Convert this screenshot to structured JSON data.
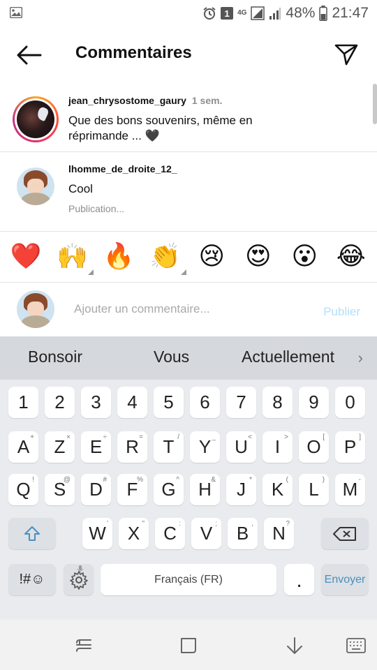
{
  "status_bar": {
    "image_icon": "image-icon",
    "alarm_icon": "alarm-icon",
    "sim_badge": "1",
    "network": "4G",
    "signal_icons": [
      "sim1-signal-icon",
      "sim2-signal-icon"
    ],
    "battery": "48%",
    "battery_icon": "battery-icon",
    "time": "21:47"
  },
  "header": {
    "title": "Commentaires",
    "back_icon": "back-arrow-icon",
    "share_icon": "paper-plane-icon"
  },
  "comments": [
    {
      "username": "jean_chrysostome_gaury",
      "time": "1 sem.",
      "text": "Que des bons souvenirs, même en réprimande ... 🖤",
      "has_story": true
    },
    {
      "username": "lhomme_de_droite_12_",
      "text": "Cool",
      "status": "Publication..."
    }
  ],
  "emoji_bar": [
    "❤️",
    "🙌",
    "🔥",
    "👏",
    "😢",
    "😍",
    "😮",
    "😂"
  ],
  "comment_input": {
    "placeholder": "Ajouter un commentaire...",
    "publish": "Publier"
  },
  "keyboard": {
    "suggestions": [
      "Bonsoir",
      "Vous",
      "Actuellement"
    ],
    "number_row": [
      "1",
      "2",
      "3",
      "4",
      "5",
      "6",
      "7",
      "8",
      "9",
      "0"
    ],
    "row1": [
      {
        "k": "A",
        "s": "+"
      },
      {
        "k": "Z",
        "s": "×"
      },
      {
        "k": "E",
        "s": "÷"
      },
      {
        "k": "R",
        "s": "="
      },
      {
        "k": "T",
        "s": "/"
      },
      {
        "k": "Y",
        "s": "_"
      },
      {
        "k": "U",
        "s": "<"
      },
      {
        "k": "I",
        "s": ">"
      },
      {
        "k": "O",
        "s": "["
      },
      {
        "k": "P",
        "s": "]"
      }
    ],
    "row2": [
      {
        "k": "Q",
        "s": "!"
      },
      {
        "k": "S",
        "s": "@"
      },
      {
        "k": "D",
        "s": "#"
      },
      {
        "k": "F",
        "s": "%"
      },
      {
        "k": "G",
        "s": "^"
      },
      {
        "k": "H",
        "s": "&"
      },
      {
        "k": "J",
        "s": "*"
      },
      {
        "k": "K",
        "s": "("
      },
      {
        "k": "L",
        "s": ")"
      },
      {
        "k": "M",
        "s": "-"
      }
    ],
    "row3": [
      {
        "k": "W",
        "s": "'"
      },
      {
        "k": "X",
        "s": "\""
      },
      {
        "k": "C",
        "s": ":"
      },
      {
        "k": "V",
        "s": ";"
      },
      {
        "k": "B",
        "s": ","
      },
      {
        "k": "N",
        "s": "?"
      }
    ],
    "symbols_key": "!#☺",
    "space_label": "Français (FR)",
    "period_key": ".",
    "enter_label": "Envoyer"
  },
  "nav": {
    "recents_icon": "recents-icon",
    "home_icon": "home-icon",
    "hide_keyboard_icon": "hide-keyboard-icon",
    "keyboard_switch_icon": "keyboard-switch-icon"
  }
}
